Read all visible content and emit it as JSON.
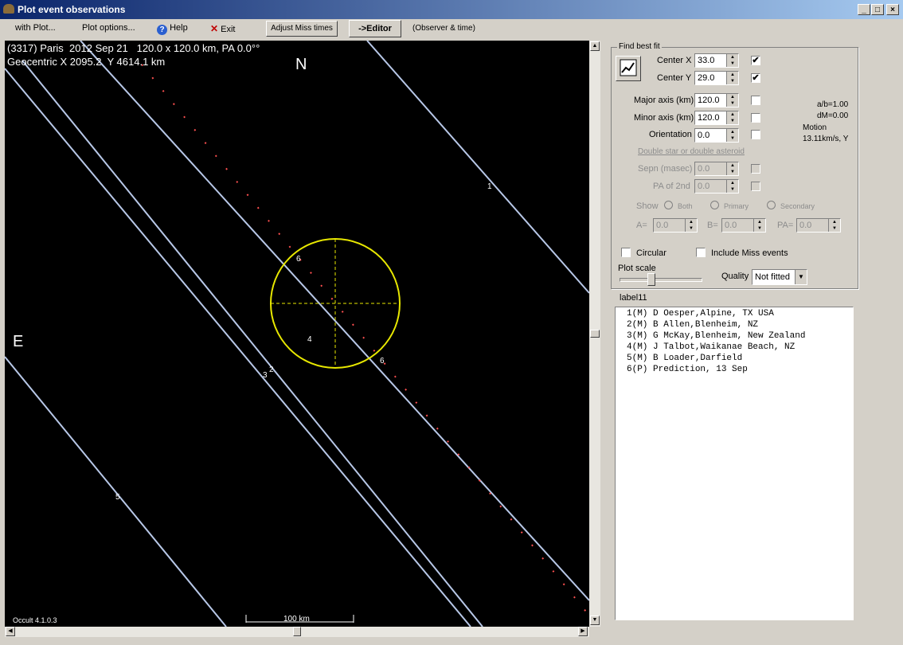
{
  "window": {
    "title": "Plot event observations"
  },
  "menu": {
    "with_plot": "with Plot...",
    "plot_options": "Plot options...",
    "help": "Help",
    "exit": "Exit",
    "adjust_miss": "Adjust Miss times",
    "editor": "->Editor",
    "observer_time": "(Observer & time)"
  },
  "plot": {
    "header_line1": "(3317) Paris  2012 Sep 21   120.0 x 120.0 km, PA 0.0°°",
    "header_line2": "Geocentric X 2095.2  Y 4614.1 km",
    "north_label": "N",
    "east_label": "E",
    "scale_label": "100 km",
    "version": "Occult 4.1.0.3",
    "chord_labels": [
      "1",
      "2",
      "3",
      "4",
      "5",
      "6",
      "6",
      "6"
    ],
    "colors": {
      "background": "#000000",
      "chord": "#b8c8e8",
      "ellipse": "#e8e800",
      "path": "#ff5050"
    }
  },
  "panel": {
    "group_title": "Find best fit",
    "center_x_label": "Center X",
    "center_x_value": "33.0",
    "center_x_checked": "✔",
    "center_y_label": "Center Y",
    "center_y_value": "29.0",
    "center_y_checked": "✔",
    "major_label": "Major axis (km)",
    "major_value": "120.0",
    "minor_label": "Minor axis (km)",
    "minor_value": "120.0",
    "orientation_label": "Orientation",
    "orientation_value": "0.0",
    "ab": "a/b=1.00",
    "dm": "dM=0.00",
    "motion_label": "Motion",
    "motion_value": "13.11km/s, Y",
    "double_label": "Double star  or  double asteroid",
    "sepn_label": "Sepn (masec)",
    "sepn_value": "0.0",
    "pa2_label": "PA of 2nd",
    "pa2_value": "0.0",
    "show_label": "Show",
    "both": "Both",
    "primary": "Primary",
    "secondary": "Secondary",
    "a_label": "A=",
    "a_value": "0.0",
    "b_label": "B=",
    "b_value": "0.0",
    "pa_label": "PA=",
    "pa_value": "0.0",
    "circular": "Circular",
    "include_miss": "Include Miss events",
    "plot_scale": "Plot scale",
    "quality_label": "Quality",
    "quality_value": "Not fitted",
    "list_label": "label11"
  },
  "observers": [
    "1(M) D Oesper,Alpine, TX USA",
    "2(M) B Allen,Blenheim, NZ",
    "3(M) G McKay,Blenheim, New Zealand",
    "4(M) J Talbot,Waikanae Beach, NZ",
    "5(M) B Loader,Darfield",
    "6(P) Prediction, 13 Sep"
  ]
}
